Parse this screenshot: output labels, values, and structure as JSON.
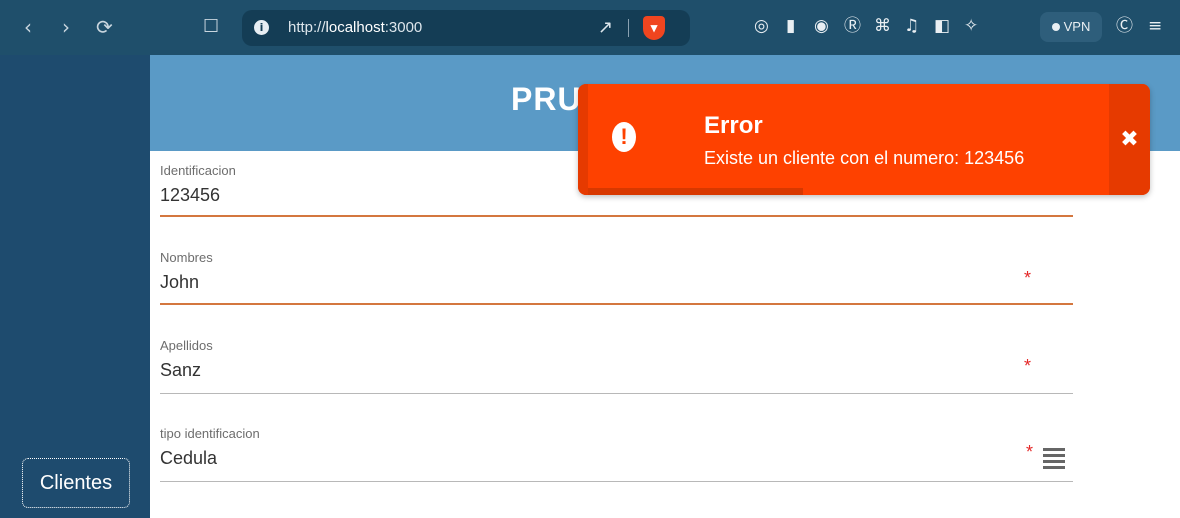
{
  "browser": {
    "url_prefix": "http://",
    "url_host": "localhost",
    "url_port": ":3000",
    "vpn_label": "VPN",
    "icons": [
      "back-icon",
      "forward-icon",
      "reload-icon",
      "bookmark-icon",
      "info-icon",
      "share-icon",
      "brave-shield-icon",
      "extension-icons",
      "sidebar-icon",
      "wallet-icon",
      "leo-icon",
      "menu-icon"
    ]
  },
  "sidebar": {
    "clientes_label": "Clientes"
  },
  "header": {
    "title": "PRU"
  },
  "form": {
    "fields": [
      {
        "label": "Identificacion",
        "value": "123456",
        "required": false
      },
      {
        "label": "Nombres",
        "value": "John",
        "required": true,
        "req_mark": "*"
      },
      {
        "label": "Apellidos",
        "value": "Sanz",
        "required": true,
        "req_mark": "*"
      },
      {
        "label": "tipo identificacion",
        "value": "Cedula",
        "required": true,
        "req_mark": "*"
      }
    ]
  },
  "toast": {
    "title": "Error",
    "message": "Existe un cliente con el numero: 123456",
    "close": "✖",
    "color": "#fe4100"
  },
  "colors": {
    "topbar": "#1f4f6b",
    "sidebar": "#1e4b6e",
    "header": "#5a9ac6",
    "active_underline": "#d4773f",
    "required": "#e42727"
  }
}
